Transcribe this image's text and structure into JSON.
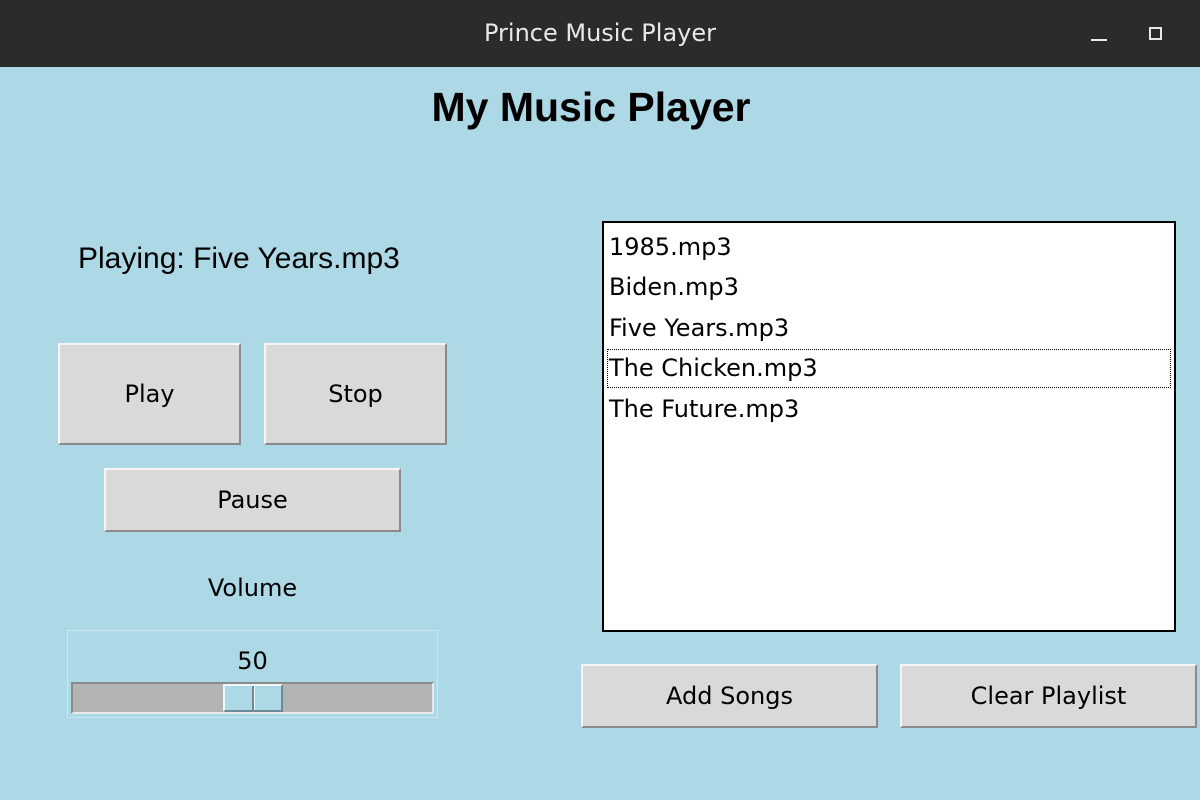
{
  "window": {
    "title": "Prince Music Player"
  },
  "app": {
    "heading": "My Music Player",
    "now_playing": "Playing: Five Years.mp3"
  },
  "controls": {
    "play_label": "Play",
    "stop_label": "Stop",
    "pause_label": "Pause"
  },
  "volume": {
    "label": "Volume",
    "value": "50",
    "min": 0,
    "max": 100
  },
  "playlist": {
    "items": [
      {
        "label": "1985.mp3"
      },
      {
        "label": "Biden.mp3"
      },
      {
        "label": "Five Years.mp3"
      },
      {
        "label": "The Chicken.mp3",
        "active": true
      },
      {
        "label": "The Future.mp3"
      }
    ]
  },
  "playlist_actions": {
    "add_label": "Add Songs",
    "clear_label": "Clear Playlist"
  },
  "colors": {
    "background": "#add8e6",
    "titlebar": "#2b2b2b",
    "button_face": "#d9d9d9",
    "close_button": "#3584e4"
  }
}
